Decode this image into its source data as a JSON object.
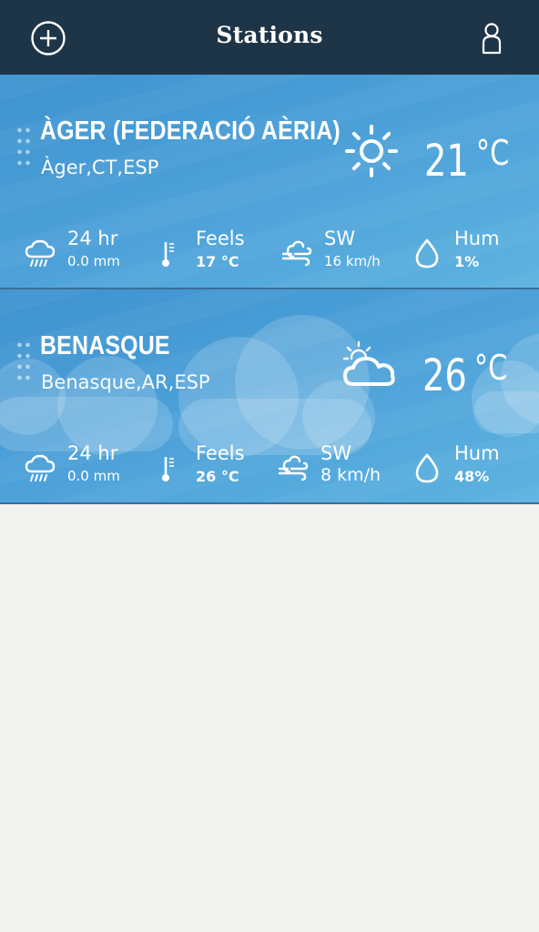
{
  "header": {
    "title": "Stations",
    "add_icon": "plus-circle-icon",
    "profile_icon": "user-icon"
  },
  "colors": {
    "header_bg": "#1e3548",
    "card_bg": "#4fa3da",
    "page_bg": "#f2f3f0"
  },
  "stations": [
    {
      "name": "ÀGER (FEDERACIÓ AÈRIA)",
      "location": "Àger,CT,ESP",
      "condition_icon": "sun-icon",
      "temp": "21",
      "temp_unit": "°C",
      "rain_label": "24 hr",
      "rain_value": "0.0 mm",
      "feels_label": "Feels",
      "feels_value": "17 °C",
      "wind_label": "SW",
      "wind_value": "16 km/h",
      "hum_label": "Hum",
      "hum_value": "1%"
    },
    {
      "name": "BENASQUE",
      "location": "Benasque,AR,ESP",
      "condition_icon": "partly-cloudy-icon",
      "temp": "26",
      "temp_unit": "°C",
      "rain_label": "24 hr",
      "rain_value": "0.0 mm",
      "feels_label": "Feels",
      "feels_value": "26 °C",
      "wind_label": "SW",
      "wind_value": "8 km/h",
      "hum_label": "Hum",
      "hum_value": "48%"
    }
  ]
}
